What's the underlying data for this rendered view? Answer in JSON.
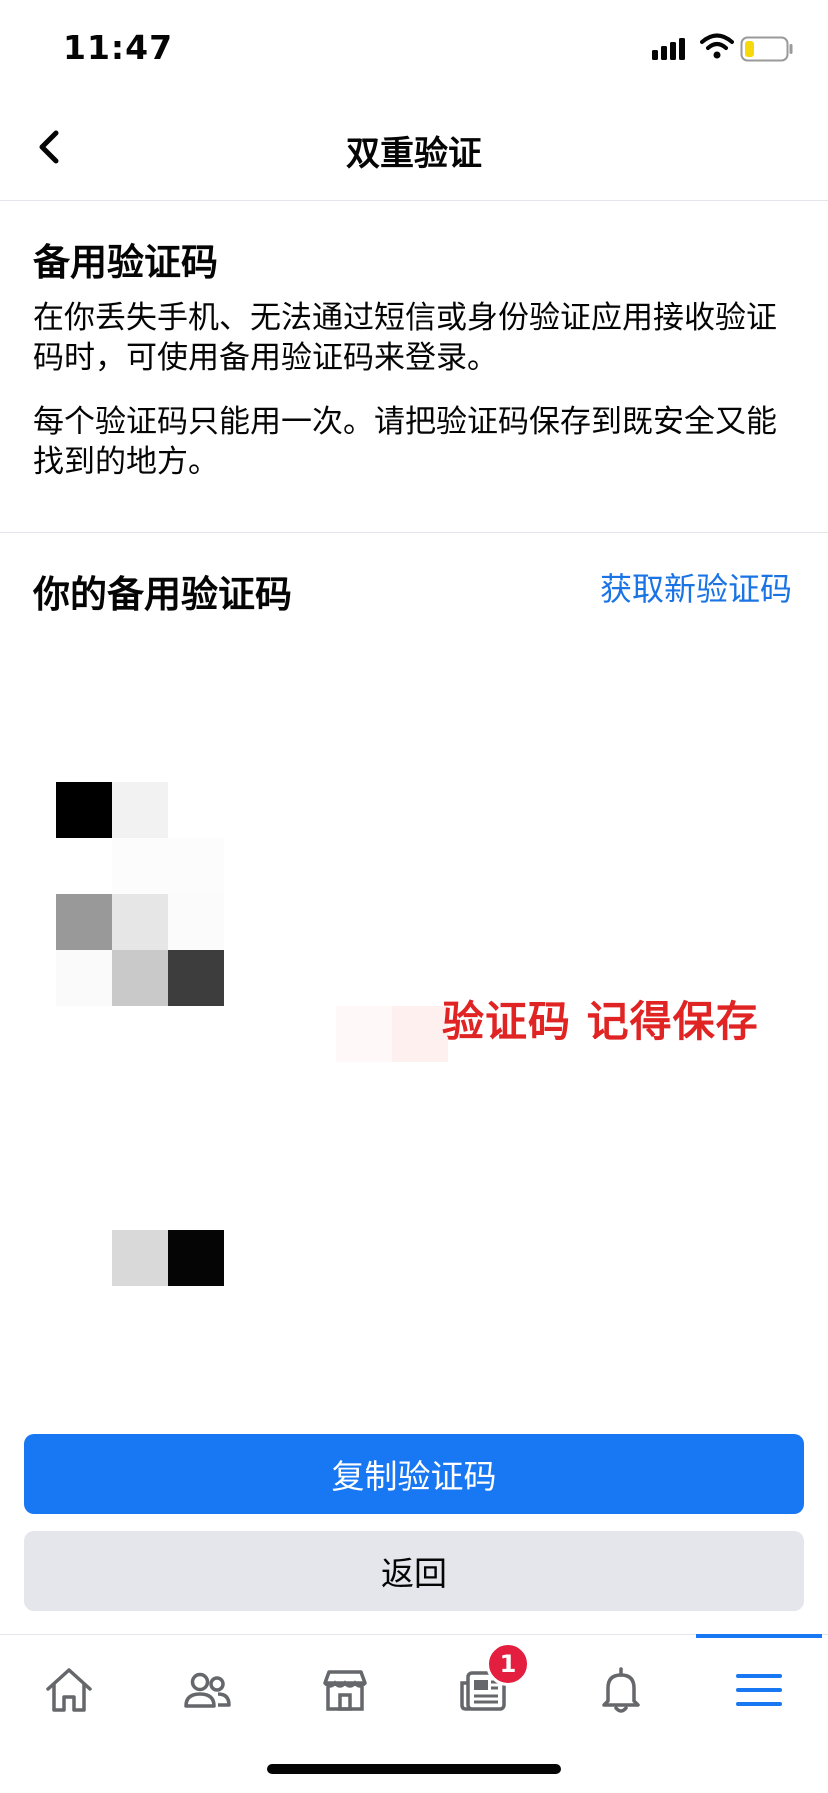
{
  "status_bar": {
    "time": "11:47",
    "battery_color": "#f5d90a"
  },
  "nav": {
    "title": "双重验证",
    "back_icon": "chevron-left-icon"
  },
  "intro": {
    "title": "备用验证码",
    "p1": "在你丢失手机、无法通过短信或身份验证应用接收验证码时，可使用备用验证码来登录。",
    "p2": "每个验证码只能用一次。请把验证码保存到既安全又能找到的地方。"
  },
  "codes": {
    "title": "你的备用验证码",
    "new_codes_link": "获取新验证码",
    "overlay_note": "验证码 记得保存",
    "link_color": "#1b74e4"
  },
  "buttons": {
    "copy": "复制验证码",
    "back": "返回",
    "primary_color": "#1877f2"
  },
  "tabbar": {
    "tabs": [
      "home-icon",
      "friends-icon",
      "marketplace-icon",
      "news-icon",
      "notifications-icon",
      "menu-icon"
    ],
    "news_badge": "1",
    "active_tab": "menu-icon"
  }
}
